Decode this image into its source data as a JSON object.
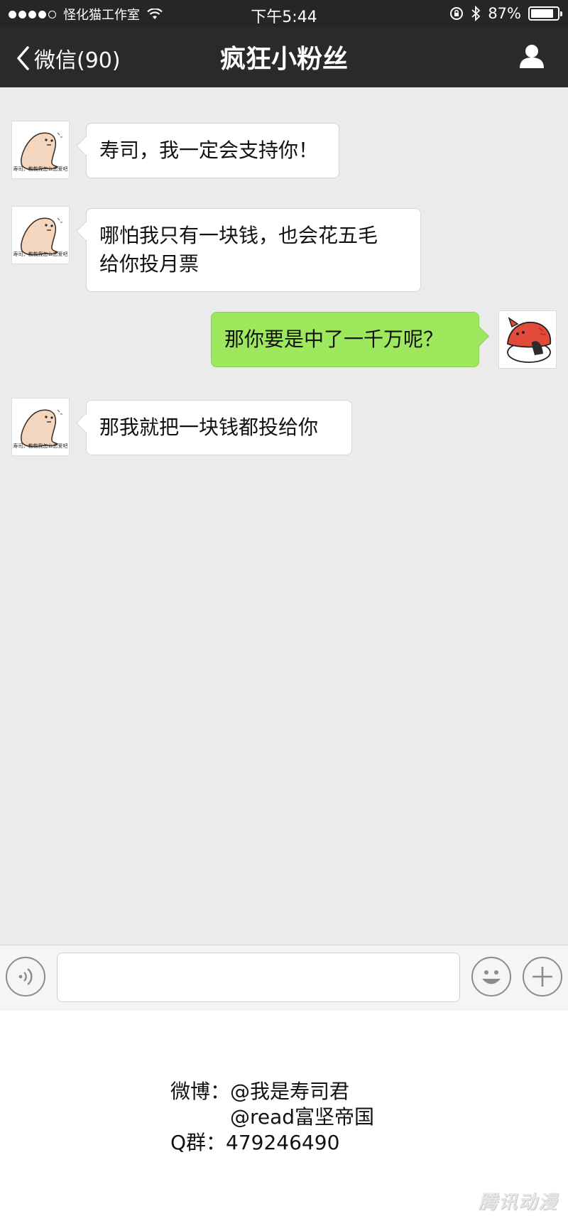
{
  "status_bar": {
    "carrier": "怪化猫工作室",
    "time": "下午5:44",
    "battery_percent": "87%",
    "battery_level": 0.87,
    "icons": [
      "wifi-icon",
      "rotation-lock-icon",
      "bluetooth-icon",
      "battery-icon"
    ]
  },
  "nav": {
    "back_label": "微信(90)",
    "title": "疯狂小粉丝",
    "icons": [
      "chevron-left-icon",
      "user-profile-icon"
    ]
  },
  "messages": [
    {
      "side": "left",
      "avatar_caption": "寿司，教教我怎么恋爱吧",
      "lines": [
        "寿司，我一定会支持你！"
      ]
    },
    {
      "side": "left",
      "avatar_caption": "寿司，教教我怎么恋爱吧",
      "lines": [
        "哪怕我只有一块钱，也会花五毛",
        "给你投月票"
      ]
    },
    {
      "side": "right",
      "avatar_caption": "",
      "lines": [
        "那你要是中了一千万呢？"
      ]
    },
    {
      "side": "left",
      "avatar_caption": "寿司，教教我怎么恋爱吧",
      "lines": [
        "那我就把一块钱都投给你"
      ]
    }
  ],
  "input_bar": {
    "value": "",
    "icons": [
      "voice-icon",
      "emoji-icon",
      "plus-icon"
    ]
  },
  "footer": {
    "weibo_label": "微博：",
    "weibo_1": "@我是寿司君",
    "weibo_2": "@read富坚帝国",
    "qq_label": "Q群：",
    "qq_number": "479246490",
    "watermark": "腾讯动漫"
  },
  "colors": {
    "header_bg": "#2a2a2a",
    "chat_bg": "#ebebeb",
    "sent_bubble": "#9ee85e",
    "received_bubble": "#ffffff"
  }
}
